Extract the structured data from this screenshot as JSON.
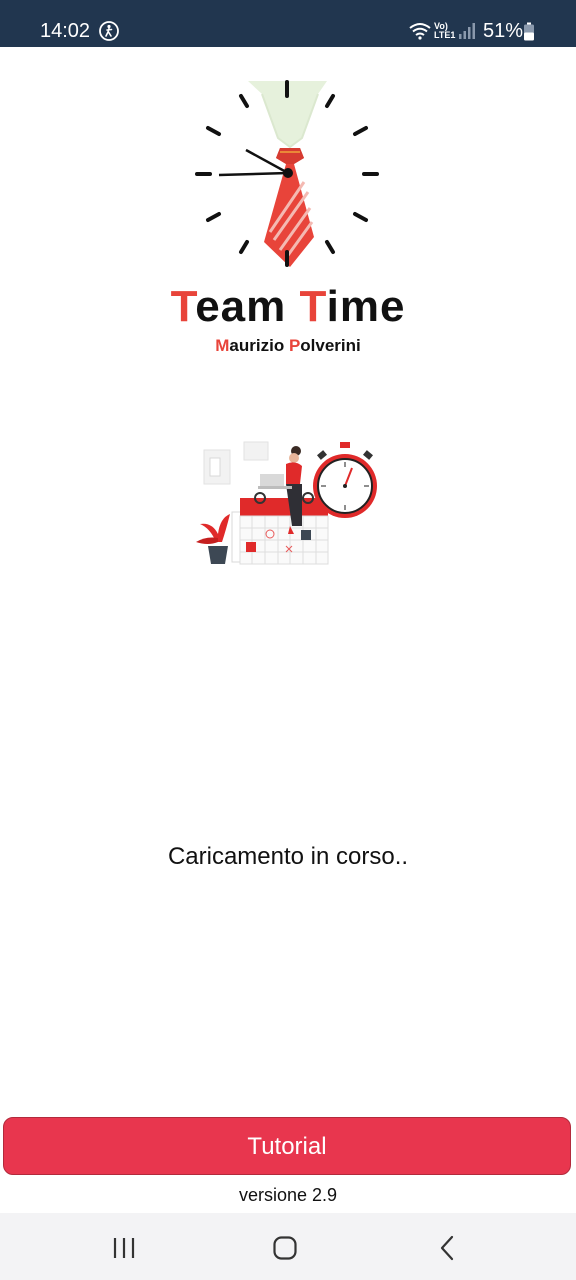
{
  "status_bar": {
    "time": "14:02",
    "network_label_top": "Vo)",
    "network_label_bottom": "LTE1",
    "battery": "51%"
  },
  "logo": {
    "title_first_letter": "T",
    "title_first_rest": "eam ",
    "title_second_letter": "T",
    "title_second_rest": "ime",
    "subtitle_first_letter": "M",
    "subtitle_first_rest": "aurizio ",
    "subtitle_second_letter": "P",
    "subtitle_second_rest": "olverini"
  },
  "loading": {
    "text": "Caricamento in corso.."
  },
  "tutorial": {
    "label": "Tutorial"
  },
  "footer": {
    "version": "versione 2.9"
  },
  "icons": {
    "accessibility": "accessibility-icon",
    "wifi": "wifi-icon",
    "signal": "signal-icon",
    "battery": "battery-icon",
    "recents": "recents-icon",
    "home": "home-icon",
    "back": "back-icon"
  },
  "colors": {
    "status_bar": "#21364f",
    "accent_red": "#e8443a",
    "button_red": "#e8364e",
    "nav_bar": "#f3f3f5"
  }
}
